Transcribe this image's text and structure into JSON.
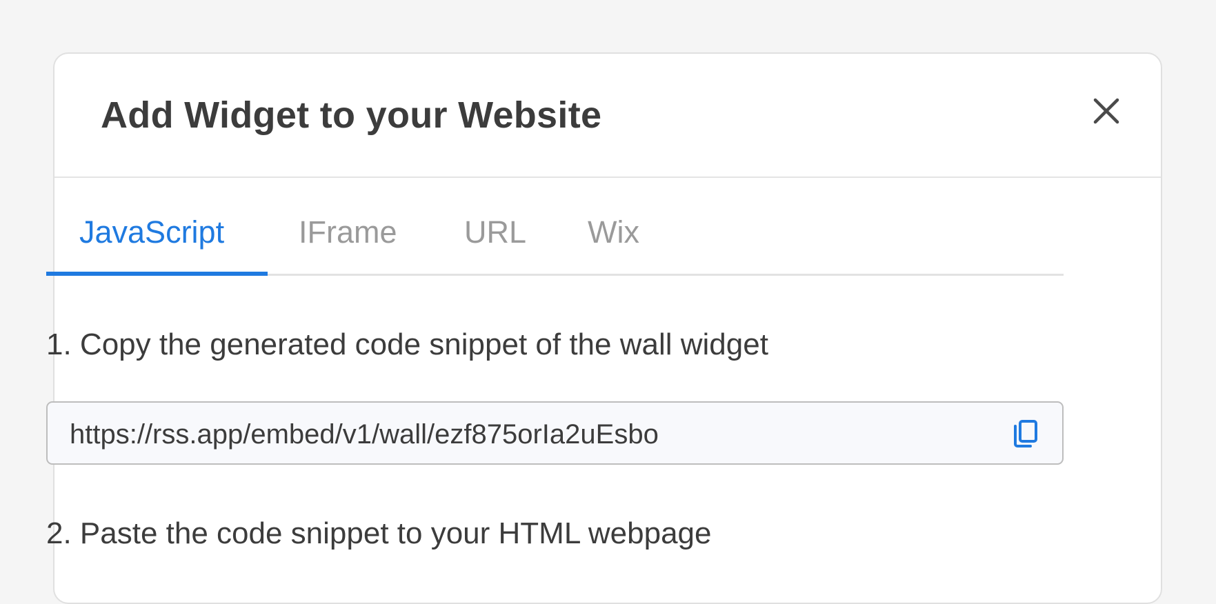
{
  "modal": {
    "title": "Add Widget to your Website",
    "close_icon": "close-icon"
  },
  "tabs": [
    {
      "label": "JavaScript",
      "active": true
    },
    {
      "label": "IFrame",
      "active": false
    },
    {
      "label": "URL",
      "active": false
    },
    {
      "label": "Wix",
      "active": false
    }
  ],
  "steps": {
    "step1": "1. Copy the generated code snippet of the wall widget",
    "step2": "2. Paste the code snippet to your HTML webpage"
  },
  "code_snippet": {
    "value": "https://rss.app/embed/v1/wall/ezf875orIa2uEsbo",
    "copy_icon": "copy-icon"
  },
  "colors": {
    "accent": "#1f7ae0",
    "text": "#3c3c3c",
    "muted": "#9a9a9a"
  }
}
